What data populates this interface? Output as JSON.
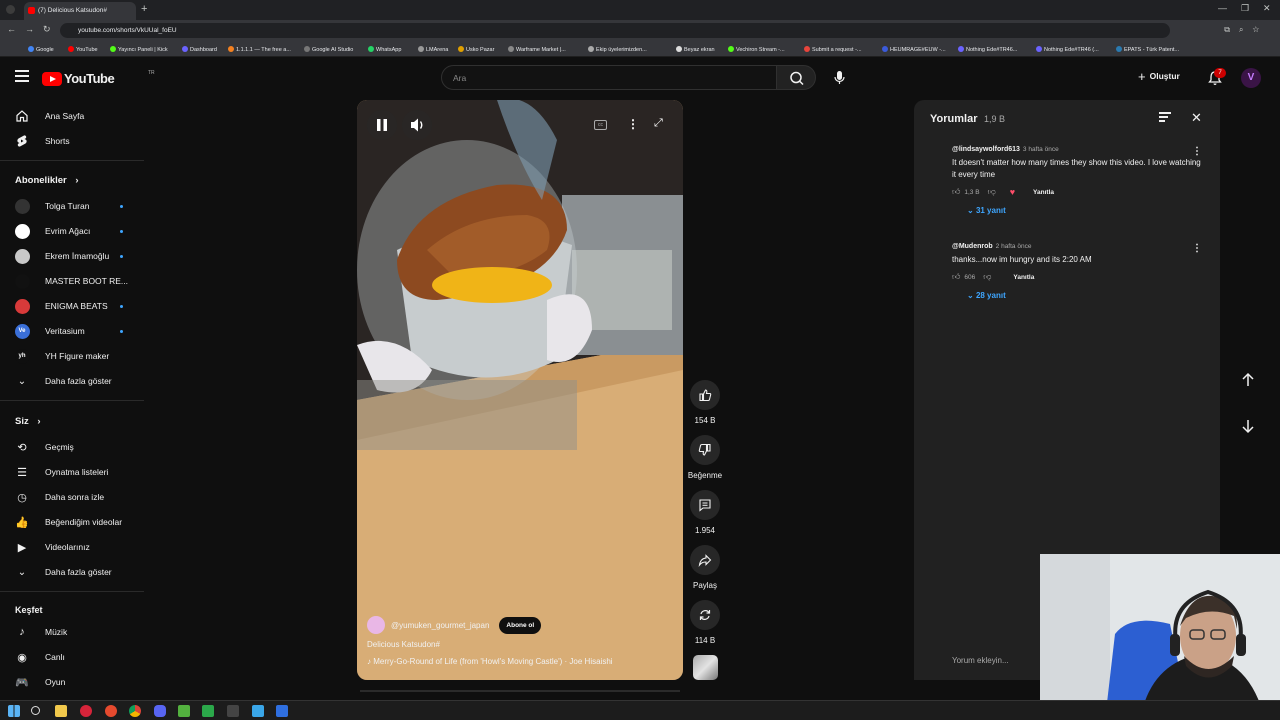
{
  "browser": {
    "tab_title": "(7) Delicious Katsudon#",
    "url": "youtube.com/shorts/VkUUal_foEU",
    "bookmarks": [
      "Google",
      "YouTube",
      "Yayıncı Paneli | Kick",
      "Dashboard",
      "1.1.1.1 — The free a...",
      "Google AI Studio",
      "WhatsApp",
      "LMArena",
      "Usko Pazar",
      "Warframe Market |...",
      "Ekip üyelerimizden...",
      "Beyaz ekran",
      "Vechiron Stream -...",
      "Submit a request -...",
      "HEUMRAGE#EUW -...",
      "Nothing Ede#TR46...",
      "Nothing Ede#TR46 (...",
      "EPATS - Türk Patent..."
    ]
  },
  "header": {
    "logo_text": "YouTube",
    "logo_region": "TR",
    "search_placeholder": "Ara",
    "create_label": "Oluştur",
    "notif_count": "7",
    "avatar_letter": "V"
  },
  "sidebar": {
    "home": "Ana Sayfa",
    "shorts": "Shorts",
    "subs_heading": "Abonelikler",
    "channels": [
      {
        "name": "Tolga Turan",
        "color": "#333333",
        "initial": ""
      },
      {
        "name": "Evrim Ağacı",
        "color": "#ffffff",
        "initial": ""
      },
      {
        "name": "Ekrem İmamoğlu",
        "color": "#c8c8c8",
        "initial": ""
      },
      {
        "name": "MASTER BOOT RE...",
        "color": "#111111",
        "initial": ""
      },
      {
        "name": "ENIGMA BEATS",
        "color": "#d83a3a",
        "initial": ""
      },
      {
        "name": "Veritasium",
        "color": "#3a6fd8",
        "initial": "Ve"
      },
      {
        "name": "YH Figure maker",
        "color": "#0f0f0f",
        "initial": "yh"
      }
    ],
    "show_more_1": "Daha fazla göster",
    "you_heading": "Siz",
    "you_items": [
      "Geçmiş",
      "Oynatma listeleri",
      "Daha sonra izle",
      "Beğendiğim videolar",
      "Videolarınız"
    ],
    "show_more_2": "Daha fazla göster",
    "explore_heading": "Keşfet",
    "explore_items": [
      "Müzik",
      "Canlı",
      "Oyun"
    ]
  },
  "video": {
    "channel": "@yumuken_gourmet_japan",
    "subscribe": "Abone ol",
    "title": "Delicious Katsudon#",
    "music": "Merry-Go-Round of Life (from 'Howl's Moving Castle') · Joe Hisaishi"
  },
  "actions": {
    "likes": "154 B",
    "dislike": "Beğenme",
    "comments": "1.954",
    "share": "Paylaş",
    "remix": "114 B"
  },
  "comments_panel": {
    "title": "Yorumlar",
    "count": "1,9 B",
    "items": [
      {
        "author": "@lindsaywolford613",
        "time": "3 hafta önce",
        "text": "It doesn't matter how many times they show this video. I love watching it every time",
        "likes": "1,3 B",
        "reply": "Yanıtla",
        "replies": "31 yanıt"
      },
      {
        "author": "@Mudenrob",
        "time": "2 hafta önce",
        "text": "thanks...now im hungry and its 2:20 AM",
        "likes": "606",
        "reply": "Yanıtla",
        "replies": "28 yanıt"
      }
    ],
    "add_placeholder": "Yorum ekleyin..."
  }
}
